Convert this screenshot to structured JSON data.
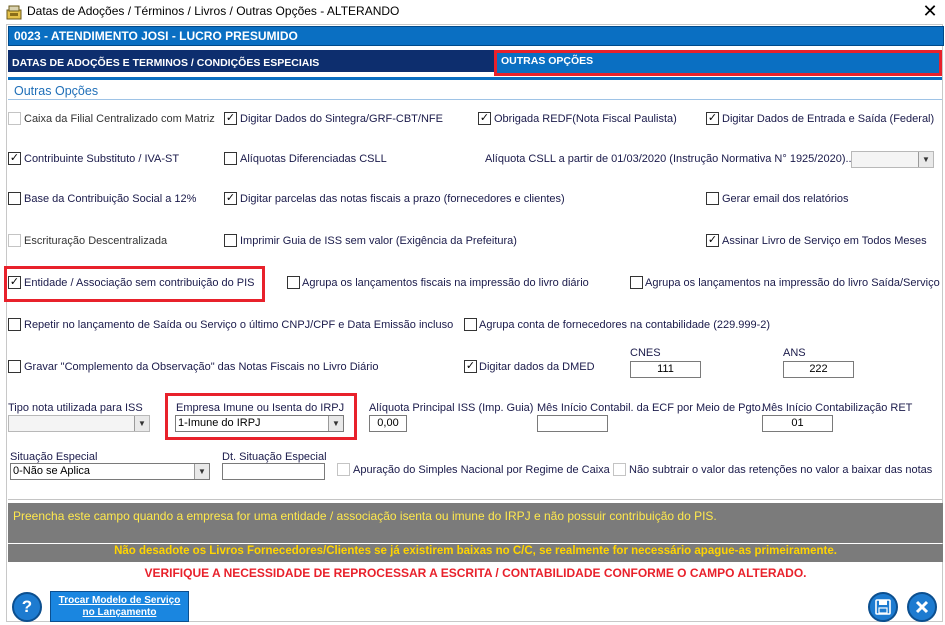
{
  "window": {
    "title": "Datas de Adoções / Términos / Livros / Outras Opções   -   ALTERANDO",
    "close_glyph": "✕"
  },
  "company": {
    "label": "0023   -   ATENDIMENTO JOSI - LUCRO PRESUMIDO"
  },
  "tabs": [
    {
      "label": "DATAS DE ADOÇÕES E TERMINOS / CONDIÇÕES ESPECIAIS"
    },
    {
      "label": "OUTRAS OPÇÕES"
    }
  ],
  "section": {
    "title": "Outras Opções"
  },
  "options": [
    {
      "label": "Caixa da Filial Centralizado com Matriz",
      "checked": false,
      "enabled": false
    },
    {
      "label": "Digitar Dados do Sintegra/GRF-CBT/NFE",
      "checked": true,
      "enabled": true
    },
    {
      "label": "Obrigada REDF(Nota Fiscal Paulista)",
      "checked": true,
      "enabled": true
    },
    {
      "label": "Digitar Dados de Entrada e Saída (Federal)",
      "checked": true,
      "enabled": true
    },
    {
      "label": "Contribuinte Substituto / IVA-ST",
      "checked": true,
      "enabled": true
    },
    {
      "label": "Alíquotas Diferenciadas CSLL",
      "checked": false,
      "enabled": true
    },
    {
      "label": "Base da Contribuição Social a 12%",
      "checked": false,
      "enabled": true
    },
    {
      "label": "Digitar parcelas das notas fiscais a prazo (fornecedores e clientes)",
      "checked": true,
      "enabled": true
    },
    {
      "label": "Gerar email dos relatórios",
      "checked": false,
      "enabled": true
    },
    {
      "label": "Escrituração Descentralizada",
      "checked": false,
      "enabled": false
    },
    {
      "label": "Imprimir Guia de ISS sem valor (Exigência da Prefeitura)",
      "checked": false,
      "enabled": true
    },
    {
      "label": "Assinar Livro de Serviço em Todos Meses",
      "checked": true,
      "enabled": true
    },
    {
      "label": "Entidade / Associação sem contribuição do PIS",
      "checked": true,
      "enabled": true
    },
    {
      "label": "Agrupa os lançamentos fiscais na impressão do livro diário",
      "checked": false,
      "enabled": true
    },
    {
      "label": "Agrupa os lançamentos na impressão do livro Saída/Serviço",
      "checked": false,
      "enabled": true
    },
    {
      "label": "Repetir no lançamento de Saída ou Serviço o último CNPJ/CPF e Data Emissão incluso",
      "checked": false,
      "enabled": true
    },
    {
      "label": "Agrupa conta de fornecedores na contabilidade (229.999-2)",
      "checked": false,
      "enabled": true
    },
    {
      "label": "Gravar \"Complemento da Observação\" das Notas Fiscais no Livro Diário",
      "checked": false,
      "enabled": true
    },
    {
      "label": "Digitar dados da DMED",
      "checked": true,
      "enabled": true
    },
    {
      "label": "Apuração do Simples Nacional por Regime de Caixa",
      "checked": false,
      "enabled": false
    },
    {
      "label": "Não subtrair o valor das retenções no valor a baixar das notas",
      "checked": false,
      "enabled": false
    }
  ],
  "csll": {
    "label": "Alíquota CSLL a partir de 01/03/2020 (Instrução Normativa N° 1925/2020)..:",
    "value": ""
  },
  "cnes": {
    "label": "CNES",
    "value": "111"
  },
  "ans": {
    "label": "ANS",
    "value": "222"
  },
  "tipo_nota": {
    "label": "Tipo nota utilizada para ISS",
    "value": ""
  },
  "imune": {
    "label": "Empresa Imune ou Isenta do IRPJ",
    "value": "1-Imune do IRPJ"
  },
  "aliquota_iss": {
    "label": "Alíquota Principal ISS (Imp. Guia)",
    "value": "0,00"
  },
  "mes_ecf": {
    "label": "Mês Início Contabil. da ECF por Meio de Pgto.",
    "value": ""
  },
  "mes_ret": {
    "label": "Mês Início Contabilização RET",
    "value": "01"
  },
  "situacao": {
    "label": "Situação Especial",
    "value": "0-Não se Aplica"
  },
  "dt_situacao": {
    "label": "Dt. Situação Especial",
    "value": ""
  },
  "messages": {
    "hint": "Preencha este campo quando a empresa for uma entidade / associação isenta ou imune do IRPJ e não possuir contribuição do PIS.",
    "warning": "Não desadote os Livros Fornecedores/Clientes se já existirem baixas no C/C, se realmente for necessário apague-as primeiramente.",
    "notice": "VERIFIQUE A NECESSIDADE DE REPROCESSAR A ESCRITA / CONTABILIDADE CONFORME O CAMPO ALTERADO."
  },
  "buttons": {
    "help": "?",
    "trocar_line1": "Trocar Modelo de Serviço",
    "trocar_line2": "no Lançamento",
    "save_icon": "save-icon",
    "close_icon": "close-icon"
  },
  "colors": {
    "accent_blue": "#0a6fc2",
    "dark_tab": "#0d2e6e",
    "highlight_red": "#e8212b",
    "hint_yellow": "#ffe94d",
    "message_gray": "#7b7b7b"
  }
}
